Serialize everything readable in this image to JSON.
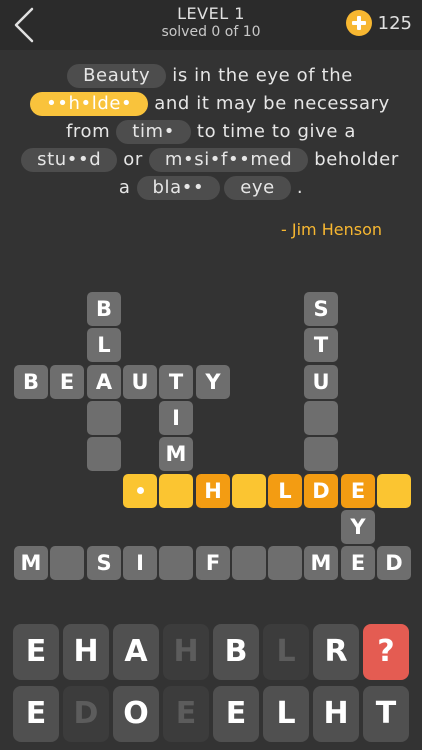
{
  "header": {
    "level": "LEVEL 1",
    "progress": "solved 0 of 10",
    "coins": "125"
  },
  "quote": {
    "lines": [
      [
        {
          "t": "pill",
          "v": "Beauty"
        },
        {
          "t": "word",
          "v": "is in the eye of the"
        }
      ],
      [
        {
          "t": "pill",
          "v": "••h•lde•",
          "active": true
        },
        {
          "t": "word",
          "v": "and it may be necessary"
        }
      ],
      [
        {
          "t": "word",
          "v": "from"
        },
        {
          "t": "pill",
          "v": "tim•"
        },
        {
          "t": "word",
          "v": "to time to give a"
        }
      ],
      [
        {
          "t": "pill",
          "v": "stu••d"
        },
        {
          "t": "word",
          "v": "or"
        },
        {
          "t": "pill",
          "v": "m•si•f••med"
        },
        {
          "t": "word",
          "v": "beholder"
        }
      ],
      [
        {
          "t": "word",
          "v": "a"
        },
        {
          "t": "pill",
          "v": "bla••"
        },
        {
          "t": "pill",
          "v": "eye"
        },
        {
          "t": "word",
          "v": "."
        }
      ]
    ],
    "author": "- Jim Henson"
  },
  "board": {
    "tiles": [
      {
        "r": 0,
        "c": 2,
        "v": "B"
      },
      {
        "r": 0,
        "c": 8,
        "v": "S"
      },
      {
        "r": 1,
        "c": 2,
        "v": "L"
      },
      {
        "r": 1,
        "c": 8,
        "v": "T"
      },
      {
        "r": 2,
        "c": 0,
        "v": "B"
      },
      {
        "r": 2,
        "c": 1,
        "v": "E"
      },
      {
        "r": 2,
        "c": 2,
        "v": "A"
      },
      {
        "r": 2,
        "c": 3,
        "v": "U"
      },
      {
        "r": 2,
        "c": 4,
        "v": "T"
      },
      {
        "r": 2,
        "c": 5,
        "v": "Y"
      },
      {
        "r": 2,
        "c": 8,
        "v": "U"
      },
      {
        "r": 3,
        "c": 2,
        "v": ""
      },
      {
        "r": 3,
        "c": 4,
        "v": "I"
      },
      {
        "r": 3,
        "c": 8,
        "v": ""
      },
      {
        "r": 4,
        "c": 2,
        "v": ""
      },
      {
        "r": 4,
        "c": 4,
        "v": "M"
      },
      {
        "r": 4,
        "c": 8,
        "v": ""
      },
      {
        "r": 5,
        "c": 3,
        "v": "•",
        "s": "y"
      },
      {
        "r": 5,
        "c": 4,
        "v": "",
        "s": "y"
      },
      {
        "r": 5,
        "c": 5,
        "v": "H",
        "s": "o"
      },
      {
        "r": 5,
        "c": 6,
        "v": "",
        "s": "y"
      },
      {
        "r": 5,
        "c": 7,
        "v": "L",
        "s": "o"
      },
      {
        "r": 5,
        "c": 8,
        "v": "D",
        "s": "o"
      },
      {
        "r": 5,
        "c": 9,
        "v": "E",
        "s": "o"
      },
      {
        "r": 5,
        "c": 10,
        "v": "",
        "s": "y"
      },
      {
        "r": 6,
        "c": 9,
        "v": "Y"
      },
      {
        "r": 7,
        "c": 0,
        "v": "M"
      },
      {
        "r": 7,
        "c": 1,
        "v": ""
      },
      {
        "r": 7,
        "c": 2,
        "v": "S"
      },
      {
        "r": 7,
        "c": 3,
        "v": "I"
      },
      {
        "r": 7,
        "c": 4,
        "v": ""
      },
      {
        "r": 7,
        "c": 5,
        "v": "F"
      },
      {
        "r": 7,
        "c": 6,
        "v": ""
      },
      {
        "r": 7,
        "c": 7,
        "v": ""
      },
      {
        "r": 7,
        "c": 8,
        "v": "M"
      },
      {
        "r": 7,
        "c": 9,
        "v": "E"
      },
      {
        "r": 7,
        "c": 10,
        "v": "D"
      }
    ]
  },
  "keyboard": {
    "rows": [
      [
        {
          "v": "E"
        },
        {
          "v": "H"
        },
        {
          "v": "A"
        },
        {
          "v": "H",
          "used": true
        },
        {
          "v": "B"
        },
        {
          "v": "L",
          "used": true
        },
        {
          "v": "R"
        },
        {
          "v": "?",
          "hint": true
        }
      ],
      [
        {
          "v": "E"
        },
        {
          "v": "D",
          "used": true
        },
        {
          "v": "O"
        },
        {
          "v": "E",
          "used": true
        },
        {
          "v": "E"
        },
        {
          "v": "L"
        },
        {
          "v": "H"
        },
        {
          "v": "T"
        }
      ]
    ]
  }
}
